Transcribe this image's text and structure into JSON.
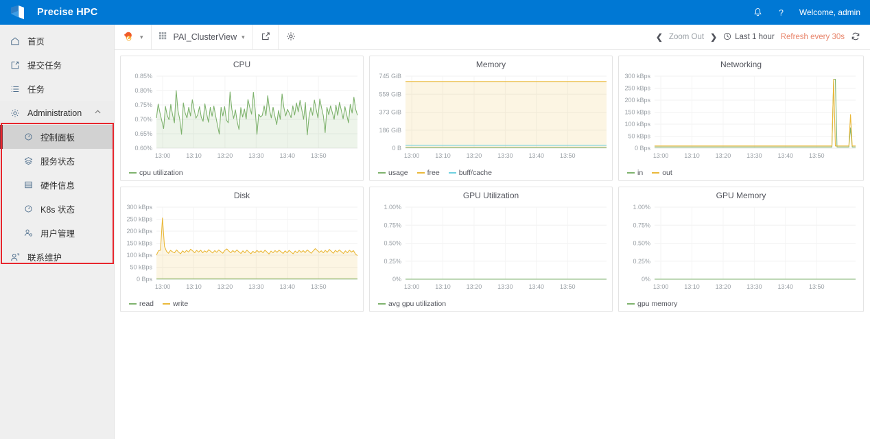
{
  "header": {
    "brand_title": "Precise HPC",
    "logo_icon": "precise-hpc-logo",
    "bell_icon": "bell-icon",
    "help_icon": "question-mark-icon",
    "welcome_text": "Welcome, admin",
    "brand_color": "#0078d4"
  },
  "sidebar": {
    "items": [
      {
        "label": "首页",
        "icon": "home-icon",
        "level": "top",
        "active": false
      },
      {
        "label": "提交任务",
        "icon": "submit-job-icon",
        "level": "top",
        "active": false
      },
      {
        "label": "任务",
        "icon": "list-icon",
        "level": "top",
        "active": false
      },
      {
        "label": "Administration",
        "icon": "gear-icon",
        "level": "group",
        "active": false,
        "chevron": "chevron-up-icon"
      },
      {
        "label": "控制面板",
        "icon": "dashboard-icon",
        "level": "sub",
        "active": true
      },
      {
        "label": "服务状态",
        "icon": "service-icon",
        "level": "sub",
        "active": false
      },
      {
        "label": "硬件信息",
        "icon": "hardware-icon",
        "level": "sub",
        "active": false
      },
      {
        "label": "K8s 状态",
        "icon": "k8s-icon",
        "level": "sub",
        "active": false
      },
      {
        "label": "用户管理",
        "icon": "user-manage-icon",
        "level": "sub",
        "active": false
      },
      {
        "label": "联系维护",
        "icon": "contact-icon",
        "level": "top",
        "active": false
      }
    ],
    "highlight_box_color": "#e8262d",
    "active_accent_color": "#8c2f39"
  },
  "grafana_toolbar": {
    "logo_icon": "grafana-logo-icon",
    "logo_caret": "caret-down-icon",
    "dashboard_icon": "dashboard-grid-icon",
    "dashboard_name": "PAI_ClusterView",
    "dashboard_caret": "caret-down-icon",
    "share_icon": "share-icon",
    "settings_icon": "gear-icon",
    "zoom_prev_icon": "chevron-left-icon",
    "zoom_out_label": "Zoom Out",
    "zoom_next_icon": "chevron-right-icon",
    "clock_icon": "clock-icon",
    "time_range": "Last 1 hour",
    "refresh_label": "Refresh every 30s",
    "refresh_icon": "refresh-icon",
    "refresh_color": "#e8846a"
  },
  "chart_data": [
    {
      "type": "line",
      "title": "CPU",
      "ylabel": "",
      "xlabel": "",
      "ytick_labels": [
        "0.60%",
        "0.65%",
        "0.70%",
        "0.75%",
        "0.80%",
        "0.85%"
      ],
      "ylim": [
        0.6,
        0.85
      ],
      "xtick_labels": [
        "13:00",
        "13:10",
        "13:20",
        "13:30",
        "13:40",
        "13:50"
      ],
      "grid": true,
      "legend_position": "bottom-left",
      "series": [
        {
          "name": "cpu utilization",
          "color": "#7eb26d",
          "fill": true,
          "values": [
            0.705,
            0.753,
            0.722,
            0.695,
            0.668,
            0.745,
            0.714,
            0.699,
            0.752,
            0.716,
            0.688,
            0.8,
            0.73,
            0.7,
            0.648,
            0.757,
            0.722,
            0.705,
            0.742,
            0.712,
            0.768,
            0.735,
            0.704,
            0.716,
            0.744,
            0.707,
            0.693,
            0.754,
            0.718,
            0.69,
            0.742,
            0.711,
            0.746,
            0.712,
            0.681,
            0.649,
            0.742,
            0.712,
            0.744,
            0.698,
            0.688,
            0.795,
            0.735,
            0.703,
            0.733,
            0.692,
            0.665,
            0.741,
            0.708,
            0.736,
            0.701,
            0.769,
            0.742,
            0.718,
            0.794,
            0.735,
            0.648,
            0.718,
            0.708,
            0.714,
            0.747,
            0.713,
            0.782,
            0.734,
            0.705,
            0.742,
            0.71,
            0.682,
            0.731,
            0.7,
            0.788,
            0.742,
            0.712,
            0.735,
            0.722,
            0.706,
            0.747,
            0.715,
            0.757,
            0.726,
            0.766,
            0.733,
            0.7,
            0.758,
            0.646,
            0.709,
            0.741,
            0.714,
            0.767,
            0.735,
            0.705,
            0.771,
            0.74,
            0.712,
            0.654,
            0.742,
            0.716,
            0.747,
            0.723,
            0.7,
            0.749,
            0.714,
            0.759,
            0.731,
            0.702,
            0.744,
            0.716,
            0.688,
            0.752,
            0.722,
            0.777,
            0.735,
            0.714
          ]
        }
      ]
    },
    {
      "type": "line",
      "title": "Memory",
      "ytick_labels": [
        "0 B",
        "186 GiB",
        "373 GiB",
        "559 GiB",
        "745 GiB"
      ],
      "ylim": [
        0,
        745
      ],
      "xtick_labels": [
        "13:00",
        "13:10",
        "13:20",
        "13:30",
        "13:40",
        "13:50"
      ],
      "grid": true,
      "legend_position": "bottom-left",
      "series": [
        {
          "name": "usage",
          "color": "#7eb26d",
          "fill": false,
          "constant": 8
        },
        {
          "name": "free",
          "color": "#eab839",
          "fill": true,
          "constant": 690
        },
        {
          "name": "buff/cache",
          "color": "#6ed0e0",
          "fill": false,
          "constant": 30
        }
      ]
    },
    {
      "type": "line",
      "title": "Networking",
      "ytick_labels": [
        "0 Bps",
        "50 kBps",
        "100 kBps",
        "150 kBps",
        "200 kBps",
        "250 kBps",
        "300 kBps"
      ],
      "ylim": [
        0,
        300
      ],
      "xtick_labels": [
        "13:00",
        "13:10",
        "13:20",
        "13:30",
        "13:40",
        "13:50"
      ],
      "grid": true,
      "legend_position": "bottom-left",
      "series": [
        {
          "name": "in",
          "color": "#7eb26d",
          "fill": false,
          "baseline": 5,
          "spikes": [
            [
              0.895,
              287
            ],
            [
              0.975,
              85
            ]
          ]
        },
        {
          "name": "out",
          "color": "#eab839",
          "fill": false,
          "baseline": 9,
          "spikes": [
            [
              0.893,
              287
            ],
            [
              0.973,
              140
            ]
          ]
        }
      ]
    },
    {
      "type": "line",
      "title": "Disk",
      "ytick_labels": [
        "0 Bps",
        "50 kBps",
        "100 kBps",
        "150 kBps",
        "200 kBps",
        "250 kBps",
        "300 kBps"
      ],
      "ylim": [
        0,
        300
      ],
      "xtick_labels": [
        "13:00",
        "13:10",
        "13:20",
        "13:30",
        "13:40",
        "13:50"
      ],
      "grid": true,
      "legend_position": "bottom-left",
      "series": [
        {
          "name": "read",
          "color": "#7eb26d",
          "fill": false,
          "constant": 1
        },
        {
          "name": "write",
          "color": "#eab839",
          "fill": true,
          "values": [
            100,
            118,
            121,
            255,
            137,
            116,
            108,
            120,
            114,
            110,
            122,
            113,
            106,
            118,
            111,
            120,
            113,
            125,
            118,
            110,
            120,
            113,
            121,
            110,
            118,
            112,
            123,
            116,
            109,
            119,
            112,
            122,
            115,
            108,
            120,
            126,
            117,
            110,
            119,
            112,
            122,
            114,
            107,
            118,
            110,
            121,
            113,
            106,
            116,
            110,
            120,
            112,
            118,
            110,
            121,
            113,
            105,
            117,
            110,
            119,
            112,
            121,
            114,
            107,
            118,
            110,
            120,
            113,
            106,
            117,
            110,
            120,
            112,
            119,
            111,
            122,
            115,
            108,
            118,
            127,
            120,
            112,
            118,
            110,
            120,
            112,
            124,
            116,
            108,
            120,
            113,
            122,
            114,
            107,
            118,
            110,
            121,
            113,
            119,
            105,
            98
          ]
        }
      ]
    },
    {
      "type": "line",
      "title": "GPU Utilization",
      "ytick_labels": [
        "0%",
        "0.25%",
        "0.50%",
        "0.75%",
        "1.00%"
      ],
      "ylim": [
        0,
        1.0
      ],
      "xtick_labels": [
        "13:00",
        "13:10",
        "13:20",
        "13:30",
        "13:40",
        "13:50"
      ],
      "grid": true,
      "legend_position": "bottom-left",
      "series": [
        {
          "name": "avg gpu utilization",
          "color": "#7eb26d",
          "fill": false,
          "constant": 0
        }
      ]
    },
    {
      "type": "line",
      "title": "GPU Memory",
      "ytick_labels": [
        "0%",
        "0.25%",
        "0.50%",
        "0.75%",
        "1.00%"
      ],
      "ylim": [
        0,
        1.0
      ],
      "xtick_labels": [
        "13:00",
        "13:10",
        "13:20",
        "13:30",
        "13:40",
        "13:50"
      ],
      "grid": true,
      "legend_position": "bottom-left",
      "series": [
        {
          "name": "gpu memory",
          "color": "#7eb26d",
          "fill": false,
          "constant": 0
        }
      ]
    }
  ]
}
